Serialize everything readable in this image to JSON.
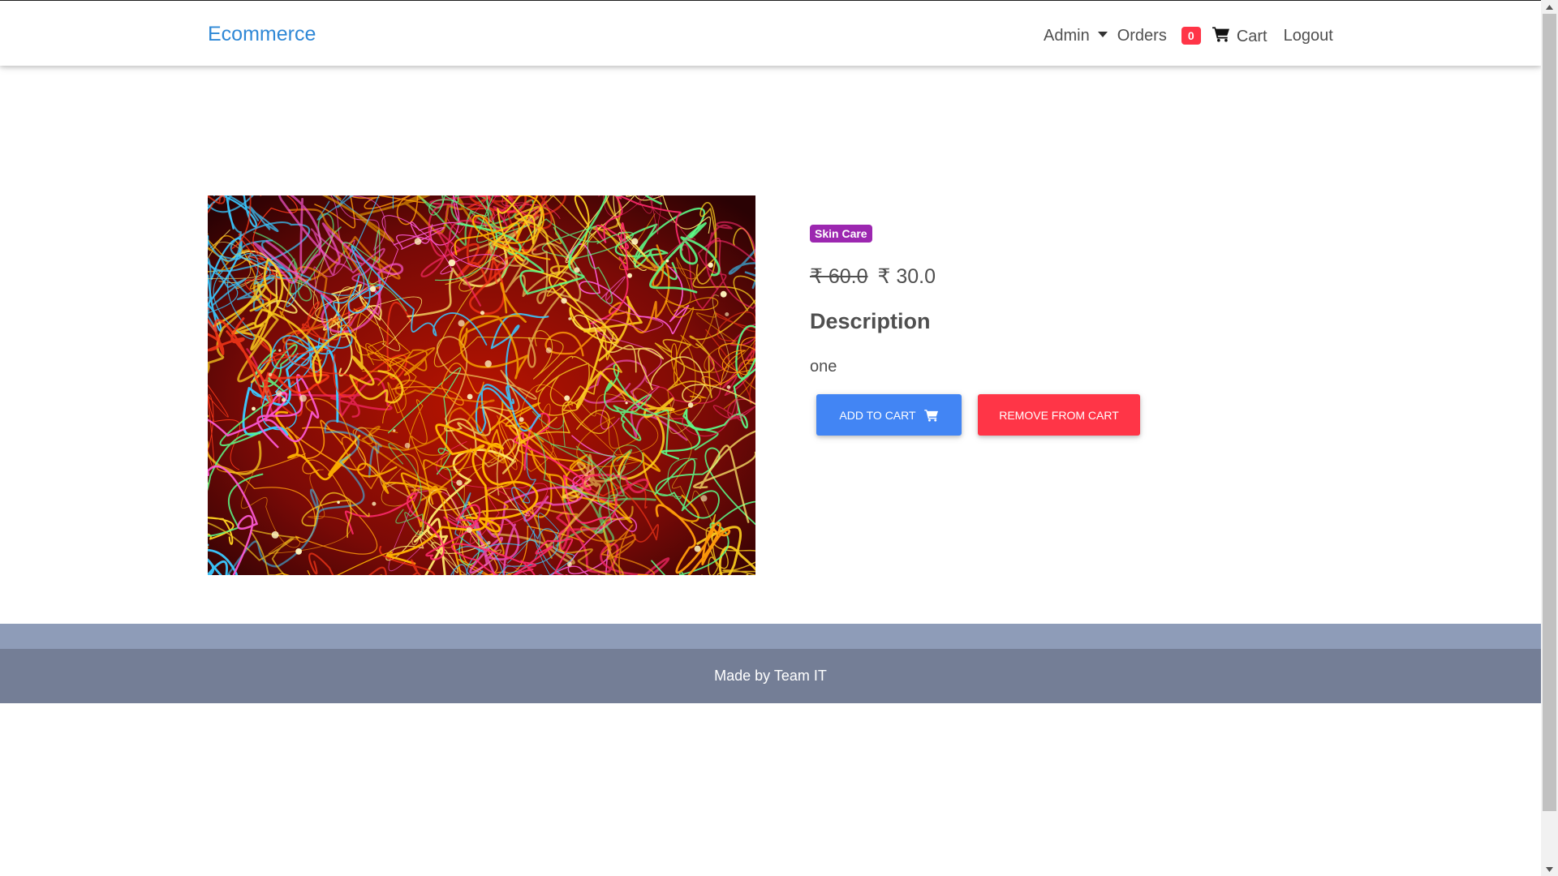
{
  "navbar": {
    "brand": "Ecommerce",
    "admin_label": "Admin",
    "orders_label": "Orders",
    "cart_count": "0",
    "cart_label": "Cart",
    "logout_label": "Logout"
  },
  "product": {
    "category": "Skin Care",
    "old_price": "₹ 60.0",
    "new_price": "₹ 30.0",
    "description_heading": "Description",
    "description": "one",
    "add_to_cart_label": "ADD TO CART",
    "remove_from_cart_label": "REMOVE FROM CART"
  },
  "footer": {
    "text": "Made by Team IT"
  },
  "icons": {
    "cart": "cart-icon",
    "caret": "caret-down-icon"
  },
  "colors": {
    "brand": "#2f88d6",
    "category_badge": "#9c27b0",
    "cart_badge": "#ff3547",
    "add_button": "#4285f4",
    "remove_button": "#ff3547",
    "footer_top": "#8e9cb8",
    "footer_bottom": "#747e96"
  }
}
